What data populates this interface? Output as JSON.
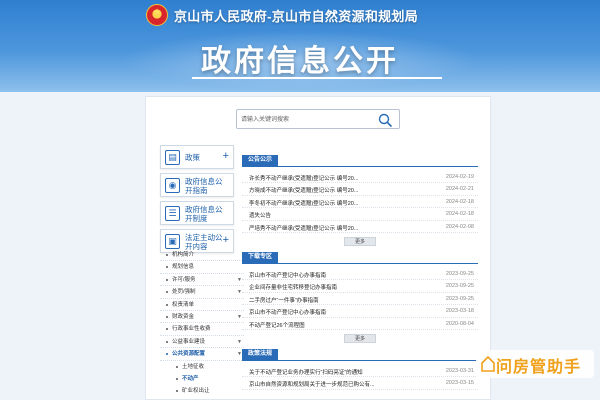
{
  "header": {
    "site_title": "京山市人民政府-京山市自然资源和规划局",
    "hero_title": "政府信息公开"
  },
  "search": {
    "placeholder": "请输入关键词搜索"
  },
  "nav": {
    "cards": [
      {
        "label": "政策",
        "icon": "document-icon"
      },
      {
        "label": "政府信息公开指南",
        "icon": "compass-icon"
      },
      {
        "label": "政府信息公开制度",
        "icon": "rules-icon"
      },
      {
        "label": "法定主动公开内容",
        "icon": "folder-icon"
      }
    ],
    "sub_items": [
      {
        "label": "机构简介",
        "expandable": false
      },
      {
        "label": "规划信息",
        "expandable": false
      },
      {
        "label": "许可/服务",
        "expandable": true
      },
      {
        "label": "处罚/强制",
        "expandable": true
      },
      {
        "label": "权责清单",
        "expandable": false
      },
      {
        "label": "财政资金",
        "expandable": true
      },
      {
        "label": "行政事业性收费",
        "expandable": false
      },
      {
        "label": "公益事业建设",
        "expandable": true
      },
      {
        "label": "公共资源配置",
        "expandable": true,
        "active": true
      }
    ],
    "child_items": [
      {
        "label": "土地征收"
      },
      {
        "label": "不动产",
        "selected": true
      },
      {
        "label": "矿业权出让"
      }
    ]
  },
  "sections": [
    {
      "title": "公告公示",
      "rows": [
        {
          "title": "许长秀不动产继承(受遗赠)登记公示 编号20...",
          "date": "2024-02-19"
        },
        {
          "title": "方晓成不动产继承(受遗赠)登记公示 编号20...",
          "date": "2024-02-21"
        },
        {
          "title": "李冬初不动产继承(受遗赠)登记公示 编号20...",
          "date": "2024-02-18"
        },
        {
          "title": "遗失公告",
          "date": "2024-02-18"
        },
        {
          "title": "严培秀不动产继承(受遗赠)登记公示 编号20...",
          "date": "2024-02-08"
        }
      ],
      "more": "更多"
    },
    {
      "title": "下载专区",
      "rows": [
        {
          "title": "京山市不动产登记中心办事指南",
          "date": "2023-09-25"
        },
        {
          "title": "企业间存量非住宅转移登记办事指南",
          "date": "2023-09-25"
        },
        {
          "title": "二手房过户“一件事”办事指南",
          "date": "2023-09-25"
        },
        {
          "title": "京山市不动产登记中心办事指南",
          "date": "2023-03-18"
        },
        {
          "title": "不动产登记26个流程图",
          "date": "2020-08-04"
        }
      ],
      "more": "更多"
    },
    {
      "title": "政策法规",
      "rows": [
        {
          "title": "关于不动产登记业务办理实行“扫码亮证”的通知",
          "date": "2023-03-31"
        },
        {
          "title": "京山市自然资源和规划局关于进一步规范已购公有...",
          "date": "2023-03-15"
        }
      ]
    }
  ],
  "watermark": {
    "text": "问房管助手"
  }
}
